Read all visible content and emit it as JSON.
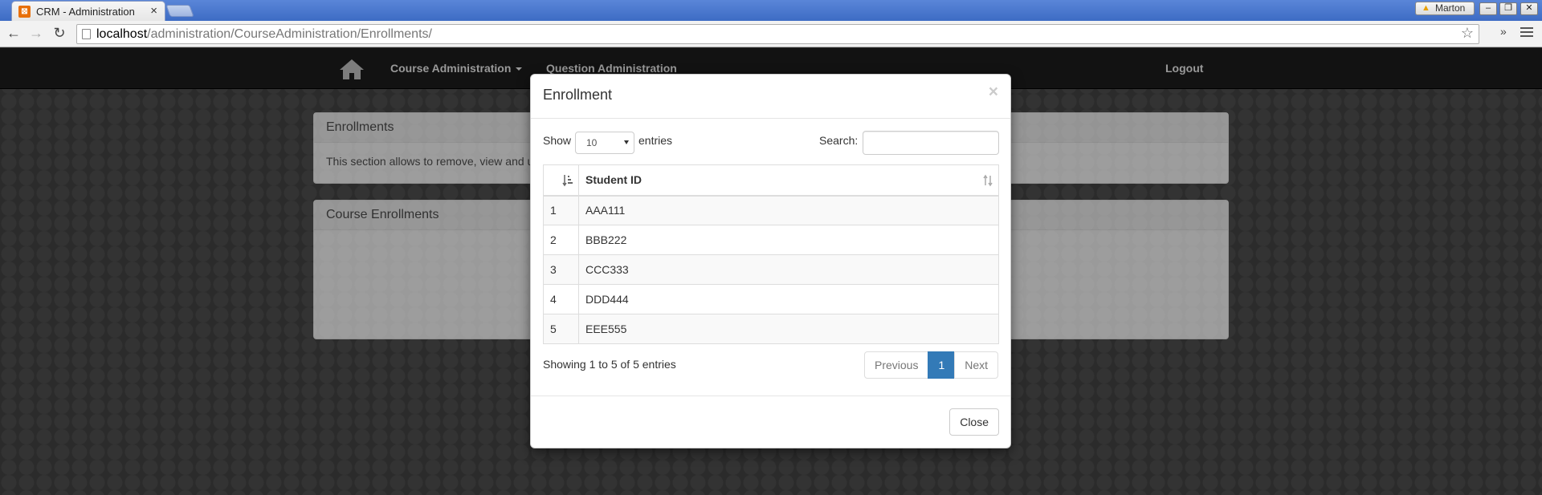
{
  "browser": {
    "tab_title": "CRM - Administration",
    "url_host": "localhost",
    "url_path": "/administration/CourseAdministration/Enrollments/",
    "profile_name": "Marton"
  },
  "navbar": {
    "course_admin": "Course Administration",
    "question_admin": "Question Administration",
    "logout": "Logout"
  },
  "panels": {
    "enrollments_title": "Enrollments",
    "enrollments_text": "This section allows to remove, view and u",
    "course_enrollments_title": "Course Enrollments"
  },
  "modal": {
    "title": "Enrollment",
    "close_x": "×",
    "show_label": "Show",
    "page_length": "10",
    "entries_label": "entries",
    "search_label": "Search:",
    "search_value": "",
    "columns": [
      "",
      "Student ID"
    ],
    "rows": [
      {
        "num": "1",
        "id": "AAA111"
      },
      {
        "num": "2",
        "id": "BBB222"
      },
      {
        "num": "3",
        "id": "CCC333"
      },
      {
        "num": "4",
        "id": "DDD444"
      },
      {
        "num": "5",
        "id": "EEE555"
      }
    ],
    "info": "Showing 1 to 5 of 5 entries",
    "pagination": {
      "previous": "Previous",
      "current": "1",
      "next": "Next"
    },
    "close_button": "Close"
  }
}
